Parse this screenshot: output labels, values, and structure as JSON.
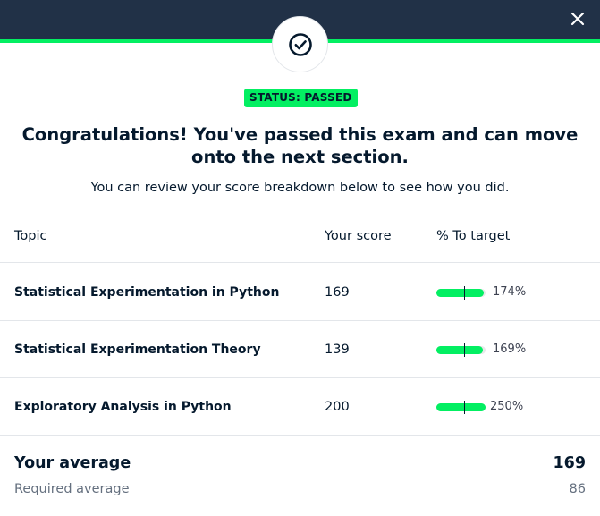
{
  "header": {
    "close_icon": "close-icon",
    "badge_icon": "check-circle-icon",
    "background_color": "#213147",
    "accent_color": "#03ef62"
  },
  "status": {
    "label": "STATUS: PASSED"
  },
  "message": {
    "headline": "Congratulations! You've passed this exam and can move onto the next section.",
    "subline": "You can review your score breakdown below to see how you did."
  },
  "table": {
    "headers": {
      "topic": "Topic",
      "score": "Your score",
      "target": "% To target"
    },
    "rows": [
      {
        "topic": "Statistical Experimentation in Python",
        "score": "169",
        "percent_label": "174%",
        "percent": 174
      },
      {
        "topic": "Statistical Experimentation Theory",
        "score": "139",
        "percent_label": "169%",
        "percent": 169
      },
      {
        "topic": "Exploratory Analysis in Python",
        "score": "200",
        "percent_label": "250%",
        "percent": 250
      }
    ]
  },
  "summary": {
    "your_average_label": "Your average",
    "your_average_value": "169",
    "required_average_label": "Required average",
    "required_average_value": "86"
  }
}
